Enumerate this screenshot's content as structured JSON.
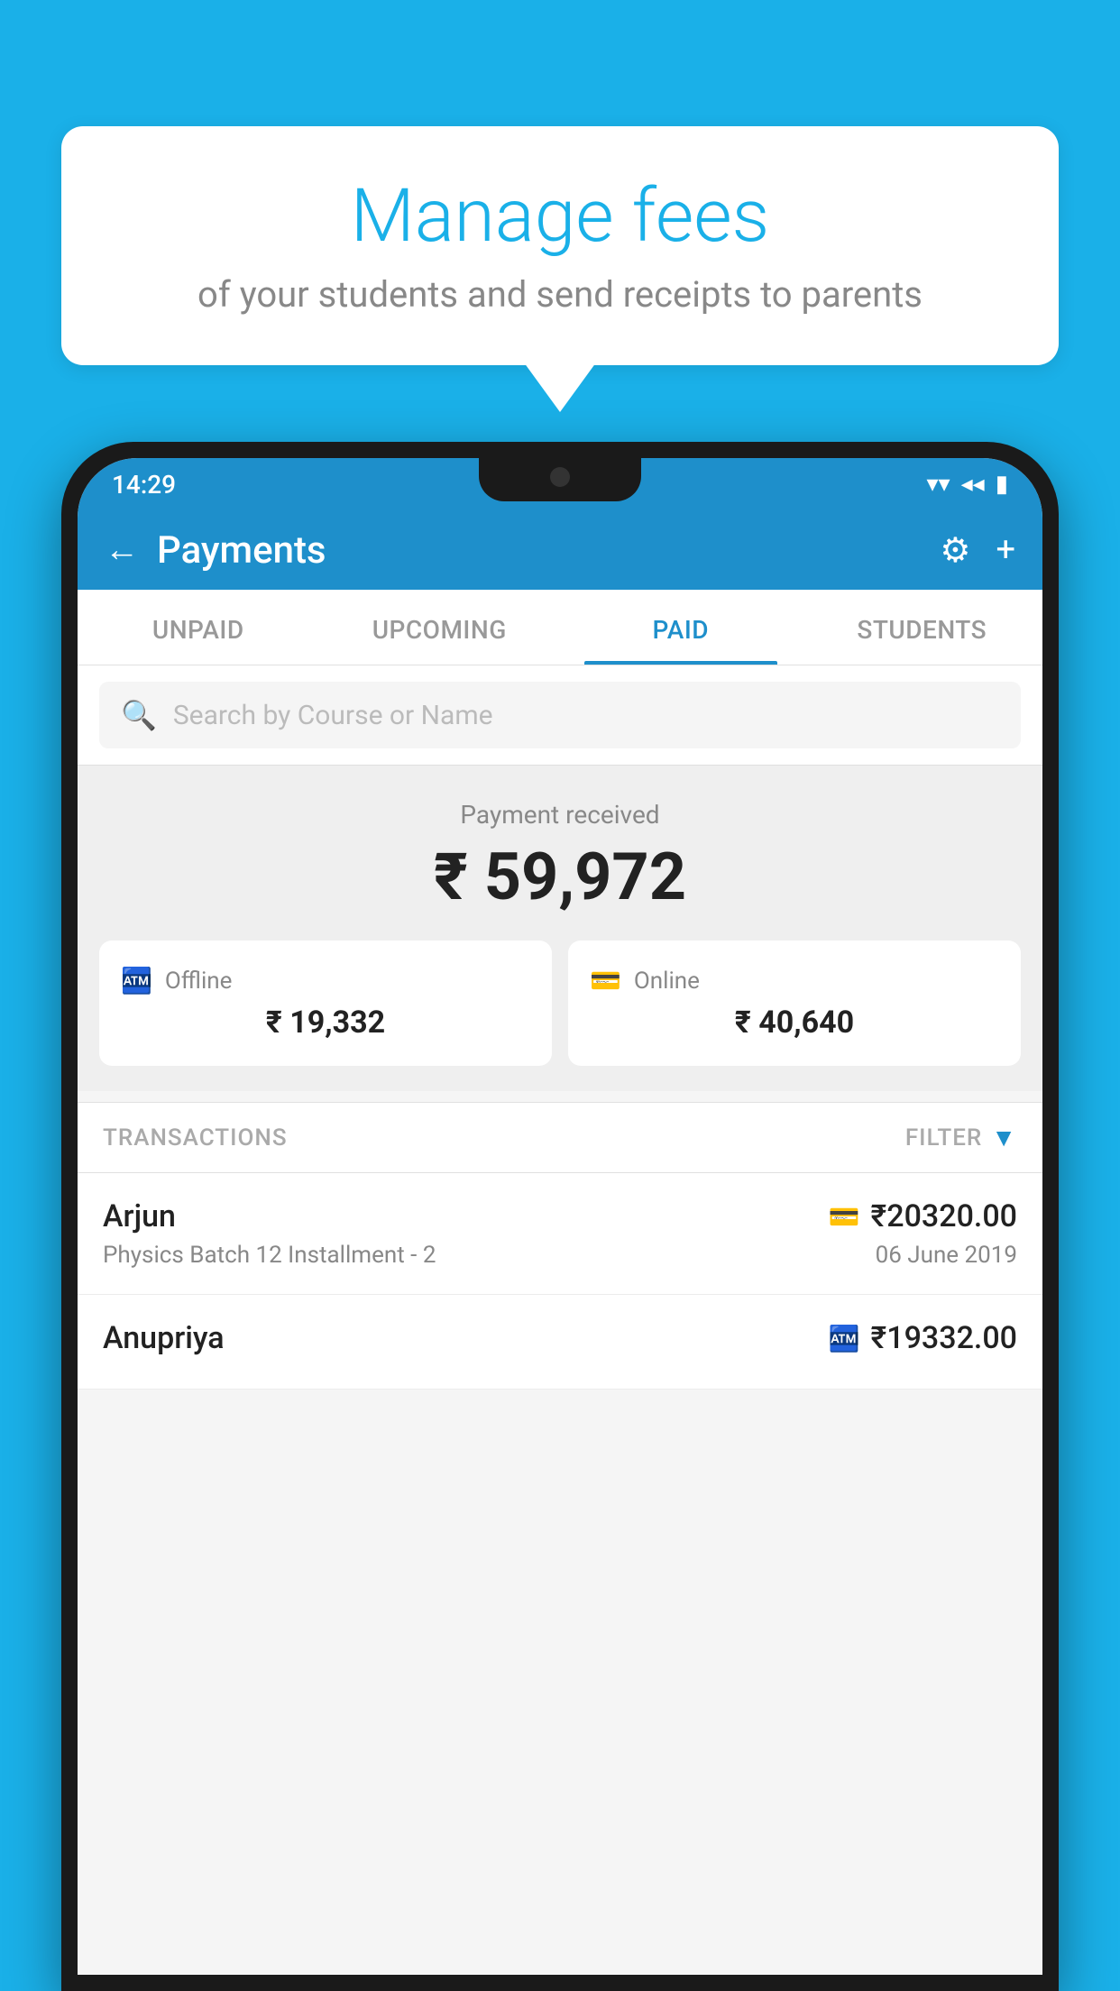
{
  "background_color": "#1ab0e8",
  "bubble": {
    "title": "Manage fees",
    "subtitle": "of your students and send receipts to parents"
  },
  "status_bar": {
    "time": "14:29",
    "wifi": "▼",
    "signal": "◀",
    "battery": "▌"
  },
  "header": {
    "title": "Payments",
    "back_label": "←",
    "gear_label": "⚙",
    "plus_label": "+"
  },
  "tabs": [
    {
      "label": "UNPAID",
      "active": false
    },
    {
      "label": "UPCOMING",
      "active": false
    },
    {
      "label": "PAID",
      "active": true
    },
    {
      "label": "STUDENTS",
      "active": false
    }
  ],
  "search": {
    "placeholder": "Search by Course or Name"
  },
  "payment_summary": {
    "label": "Payment received",
    "amount": "₹ 59,972",
    "offline": {
      "label": "Offline",
      "amount": "₹ 19,332"
    },
    "online": {
      "label": "Online",
      "amount": "₹ 40,640"
    }
  },
  "transactions": {
    "label": "TRANSACTIONS",
    "filter_label": "FILTER",
    "items": [
      {
        "name": "Arjun",
        "course": "Physics Batch 12 Installment - 2",
        "amount": "₹20320.00",
        "date": "06 June 2019",
        "payment_type": "online"
      },
      {
        "name": "Anupriya",
        "course": "",
        "amount": "₹19332.00",
        "date": "",
        "payment_type": "offline"
      }
    ]
  }
}
